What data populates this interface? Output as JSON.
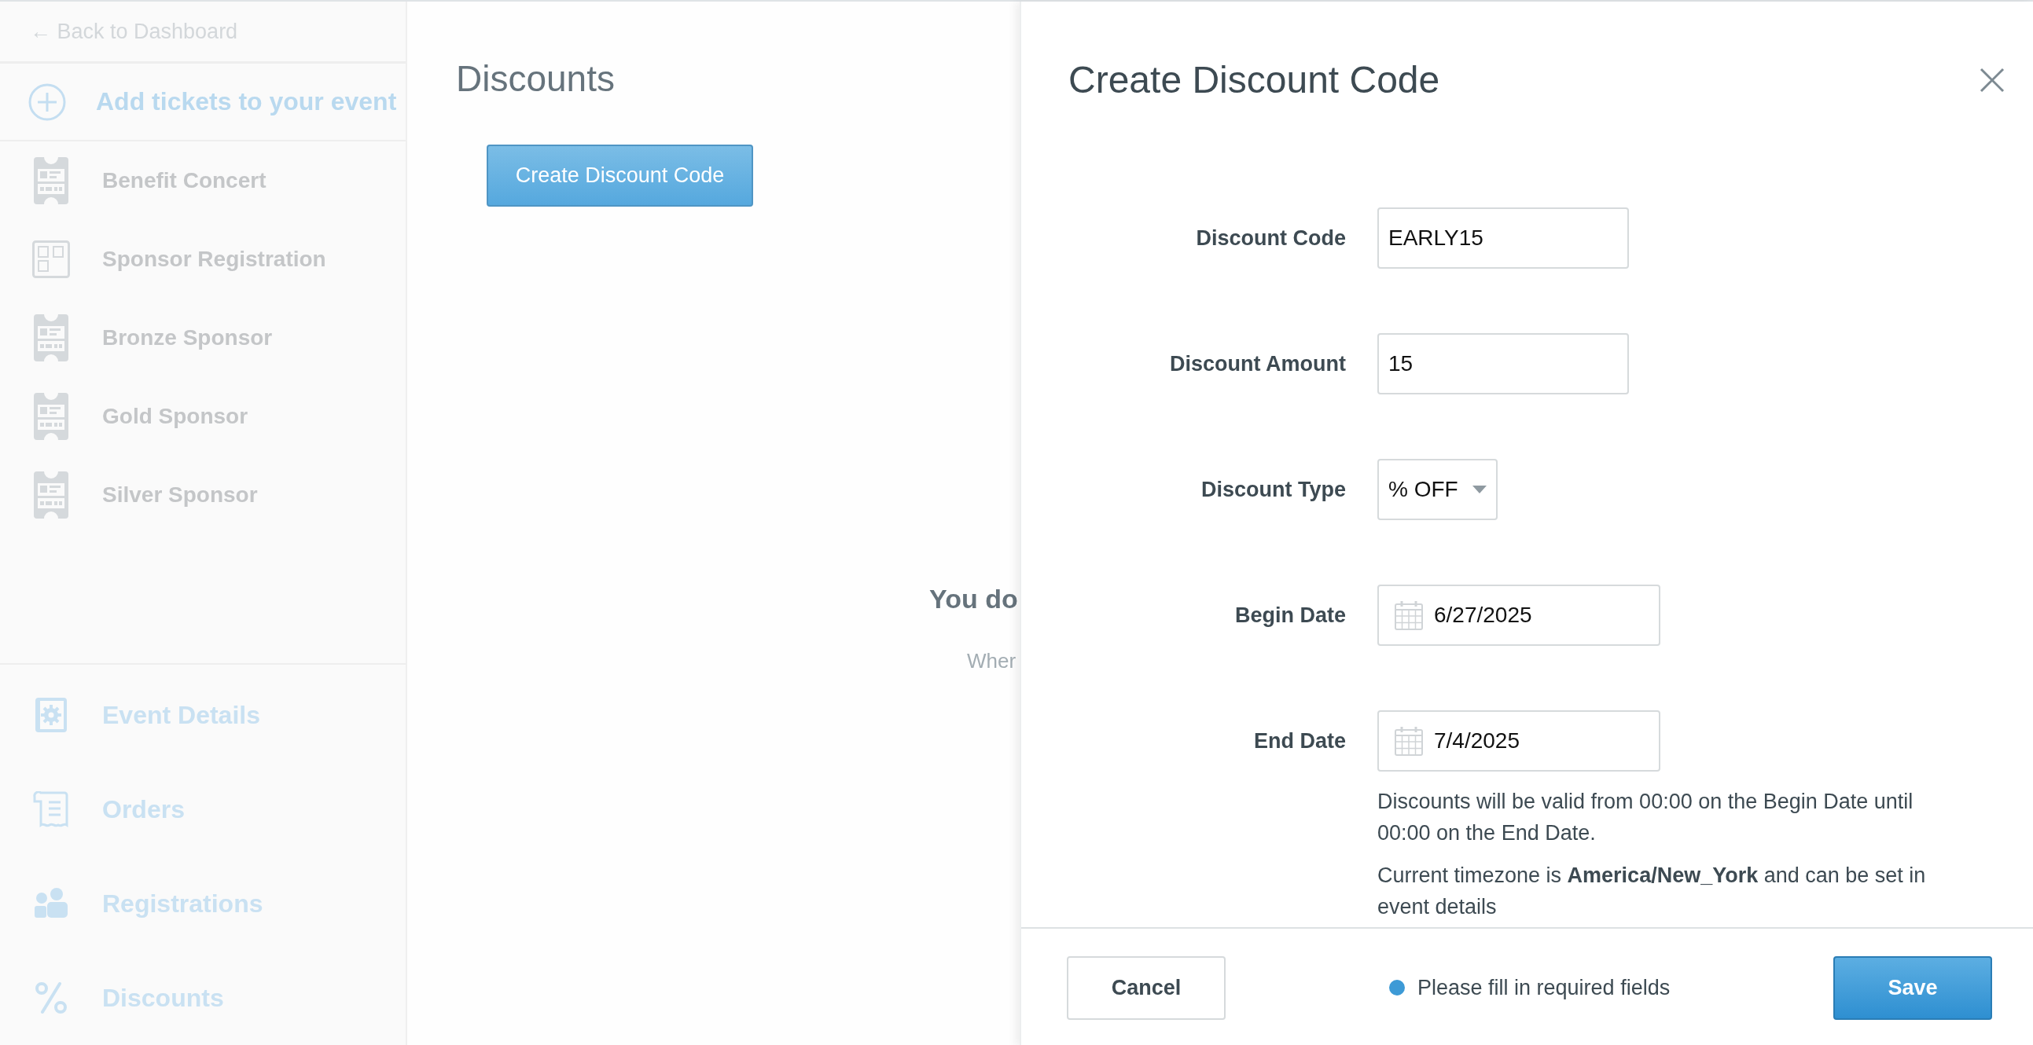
{
  "sidebar": {
    "back_link": "← Back to Dashboard",
    "add_tickets": "Add tickets to your event",
    "tickets": [
      {
        "label": "Benefit Concert",
        "kind": "ticket"
      },
      {
        "label": "Sponsor Registration",
        "kind": "bundle"
      },
      {
        "label": "Bronze Sponsor",
        "kind": "ticket"
      },
      {
        "label": "Gold Sponsor",
        "kind": "ticket"
      },
      {
        "label": "Silver Sponsor",
        "kind": "ticket"
      }
    ],
    "nav": [
      {
        "label": "Event Details",
        "kind": "settings"
      },
      {
        "label": "Orders",
        "kind": "receipt"
      },
      {
        "label": "Registrations",
        "kind": "people"
      },
      {
        "label": "Discounts",
        "kind": "percent"
      }
    ]
  },
  "main": {
    "title": "Discounts",
    "create_button": "Create Discount Code",
    "empty_title": "You do",
    "empty_text": "Wher"
  },
  "panel": {
    "title": "Create Discount Code",
    "fields": [
      {
        "label": "Discount Code",
        "kind": "text",
        "value": "EARLY15"
      },
      {
        "label": "Discount Amount",
        "kind": "text",
        "value": "15"
      },
      {
        "label": "Discount Type",
        "kind": "select",
        "value": "% OFF"
      },
      {
        "label": "Begin Date",
        "kind": "date",
        "value": "6/27/2025"
      },
      {
        "label": "End Date",
        "kind": "date",
        "value": "7/4/2025"
      }
    ],
    "help": [
      "Discounts will be valid from 00:00 on the Begin Date until 00:00 on the End Date.",
      "Current timezone is **America/New_York** and can be set in event details"
    ],
    "footer": {
      "cancel": "Cancel",
      "status": "Please fill in required fields",
      "save": "Save"
    }
  }
}
